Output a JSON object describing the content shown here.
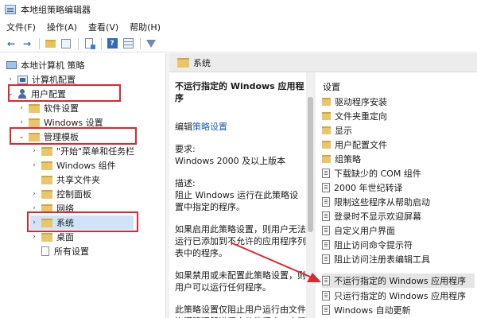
{
  "window": {
    "title": "本地组策略编辑器"
  },
  "menu": [
    "文件(F)",
    "操作(A)",
    "查看(V)",
    "帮助(H)"
  ],
  "toolbar": {
    "back": "←",
    "forward": "→",
    "help": "?"
  },
  "tree": {
    "root": "本地计算机 策略",
    "computer_config": "计算机配置",
    "user_config": "用户配置",
    "software_settings": "软件设置",
    "windows_settings": "Windows 设置",
    "admin_templates": "管理模板",
    "start_menu": "\"开始\"菜单和任务栏",
    "windows_components": "Windows 组件",
    "shared_folders": "共享文件夹",
    "control_panel": "控制面板",
    "network": "网络",
    "system": "系统",
    "desktop": "桌面",
    "all_settings": "所有设置"
  },
  "right_header": {
    "title": "系统"
  },
  "description": {
    "title": "不运行指定的 Windows 应用程序",
    "edit_prefix": "编辑",
    "edit_link": "策略设置",
    "requirement_label": "要求:",
    "requirement_value": "Windows 2000 及以上版本",
    "desc_label": "描述:",
    "desc_text": "阻止 Windows 运行在此策略设置中指定的程序。",
    "enabled_text": "如果启用此策略设置，则用户无法运行已添加到不允许的应用程序列表中的程序。",
    "disabled_text": "如果禁用或未配置此策略设置，则用户可以运行任何程序。",
    "more_text": "此策略设置仅阻止用户运行由文件资源管理器进程启动的程序。它不"
  },
  "list": {
    "header": "设置",
    "items": [
      {
        "label": "驱动程序安装",
        "icon": "folder"
      },
      {
        "label": "文件夹重定向",
        "icon": "folder"
      },
      {
        "label": "显示",
        "icon": "folder"
      },
      {
        "label": "用户配置文件",
        "icon": "folder"
      },
      {
        "label": "组策略",
        "icon": "folder"
      },
      {
        "label": "下载缺少的 COM 组件",
        "icon": "policy"
      },
      {
        "label": "2000 年世纪转译",
        "icon": "policy"
      },
      {
        "label": "限制这些程序从帮助启动",
        "icon": "policy"
      },
      {
        "label": "登录时不显示欢迎屏幕",
        "icon": "policy"
      },
      {
        "label": "自定义用户界面",
        "icon": "policy"
      },
      {
        "label": "阻止访问命令提示符",
        "icon": "policy"
      },
      {
        "label": "阻止访问注册表编辑工具",
        "icon": "policy"
      },
      {
        "label": "不运行指定的 Windows 应用程序",
        "icon": "policy"
      },
      {
        "label": "只运行指定的 Windows 应用程序",
        "icon": "policy"
      },
      {
        "label": "Windows 自动更新",
        "icon": "policy"
      }
    ]
  },
  "colors": {
    "highlight": "#e0262f",
    "link": "#1d5fb6",
    "folder": "#e9c66a"
  }
}
